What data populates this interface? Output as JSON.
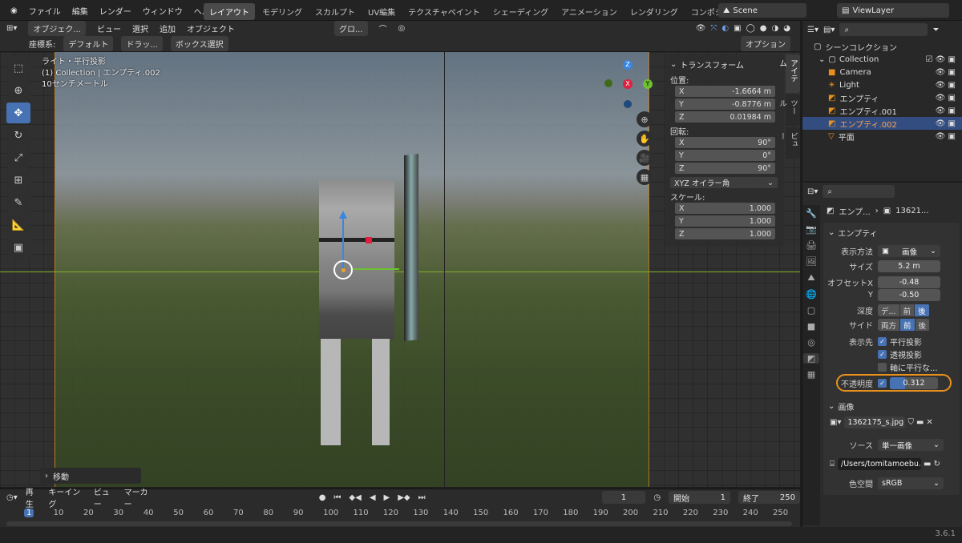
{
  "menu": [
    "ファイル",
    "編集",
    "レンダー",
    "ウィンドウ",
    "ヘルプ"
  ],
  "workspaces": [
    "レイアウト",
    "モデリング",
    "スカルプト",
    "UV編集",
    "テクスチャペイント",
    "シェーディング",
    "アニメーション",
    "レンダリング",
    "コンポジティング"
  ],
  "scene": "Scene",
  "viewlayer": "ViewLayer",
  "header": {
    "mode": "オブジェク...",
    "items": [
      "ビュー",
      "選択",
      "追加",
      "オブジェクト"
    ],
    "orient": "グロ...",
    "coords_label": "座標系:",
    "coords_value": "デフォルト",
    "drag": "ドラッ...",
    "box": "ボックス選択",
    "options": "オプション"
  },
  "viewport": {
    "line1": "ライト・平行投影",
    "line2": "(1) Collection | エンプティ.002",
    "line3": "10センチメートル",
    "last_op": "移動"
  },
  "npanel": {
    "title": "トランスフォーム",
    "loc_label": "位置:",
    "loc": [
      "-1.6664 m",
      "-0.8776 m",
      "0.01984 m"
    ],
    "rot_label": "回転:",
    "rot": [
      "90°",
      "0°",
      "90°"
    ],
    "rot_mode": "XYZ オイラー角",
    "scale_label": "スケール:",
    "scale": [
      "1.000",
      "1.000",
      "1.000"
    ],
    "axes": [
      "X",
      "Y",
      "Z"
    ]
  },
  "sidetabs": [
    "アイテム",
    "ツール",
    "ビュー"
  ],
  "outliner": {
    "root": "シーンコレクション",
    "collection": "Collection",
    "items": [
      "Camera",
      "Light",
      "エンプティ",
      "エンプティ.001",
      "エンプティ.002",
      "平面"
    ],
    "selected": 4
  },
  "props": {
    "crumb1": "エンプ...",
    "crumb2": "13621...",
    "section": "エンプティ",
    "display_label": "表示方法",
    "display": "画像",
    "size_label": "サイズ",
    "size": "5.2 m",
    "offx_label": "オフセットX",
    "offx": "-0.48",
    "offy_label": "Y",
    "offy": "-0.50",
    "depth_label": "深度",
    "depth": [
      "デ...",
      "前",
      "後"
    ],
    "side_label": "サイド",
    "side": [
      "両方",
      "前",
      "後"
    ],
    "show_label": "表示先",
    "show1": "平行投影",
    "show2": "透視投影",
    "show3": "軸に平行な...",
    "opacity_label": "不透明度",
    "opacity": "0.312",
    "image_section": "画像",
    "image_name": "1362175_s.jpg",
    "source_label": "ソース",
    "source": "単一画像",
    "path": "/Users/tomitamoebu...",
    "cs_label": "色空間",
    "cs": "sRGB"
  },
  "timeline": {
    "play": "再生",
    "keying": "キーイング",
    "view": "ビュー",
    "marker": "マーカー",
    "frame": "1",
    "start_label": "開始",
    "start": "1",
    "end_label": "終了",
    "end": "250",
    "ticks": [
      "1",
      "10",
      "20",
      "30",
      "40",
      "50",
      "60",
      "70",
      "80",
      "90",
      "100",
      "110",
      "120",
      "130",
      "140",
      "150",
      "160",
      "170",
      "180",
      "190",
      "200",
      "210",
      "220",
      "230",
      "240",
      "250"
    ]
  },
  "version": "3.6.1",
  "colors": {
    "accent": "#4772b3",
    "highlight": "#e8901c"
  }
}
